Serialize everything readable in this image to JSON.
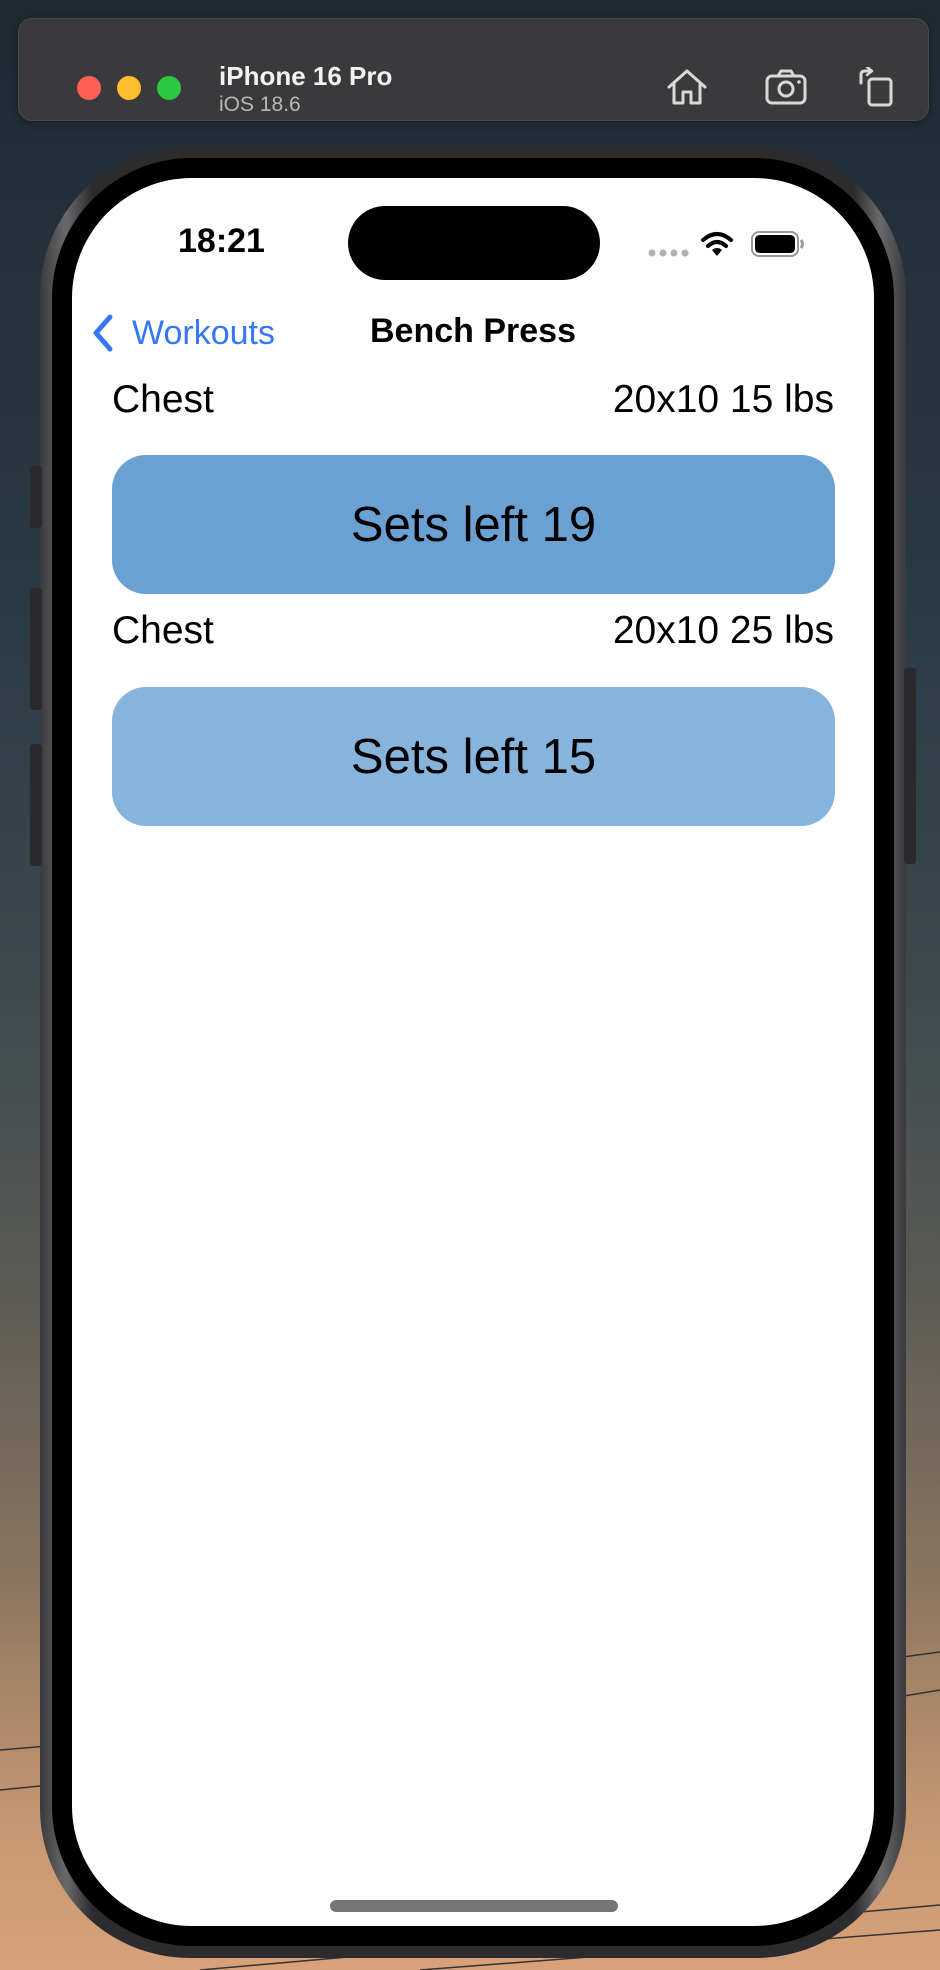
{
  "simulator": {
    "device_name": "iPhone 16 Pro",
    "os_version": "iOS 18.6",
    "toolbar_icons": [
      "home-icon",
      "screenshot-icon",
      "rotate-icon"
    ]
  },
  "status_bar": {
    "time": "18:21"
  },
  "nav": {
    "back_label": "Workouts",
    "title": "Bench Press"
  },
  "exercises": [
    {
      "muscle": "Chest",
      "detail": "20x10 15 lbs",
      "button_label": "Sets left 19",
      "button_color": "#6aa0d2"
    },
    {
      "muscle": "Chest",
      "detail": "20x10 25 lbs",
      "button_label": "Sets left 15",
      "button_color": "#87b4dc"
    }
  ],
  "colors": {
    "accent": "#3478f6",
    "screen_bg": "#ffffff"
  }
}
